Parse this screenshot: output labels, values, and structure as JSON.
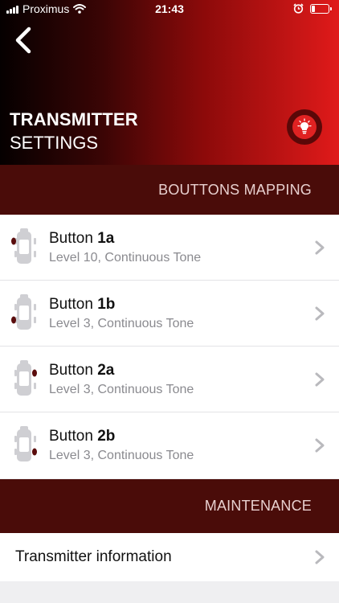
{
  "status_bar": {
    "carrier": "Proximus",
    "time": "21:43",
    "battery_level": 0.2
  },
  "header": {
    "back_icon": "chevron-left-icon",
    "title_line1": "TRANSMITTER",
    "title_line2": "SETTINGS",
    "action_icon": "lightbulb-icon"
  },
  "sections": {
    "buttons_mapping": "BOUTTONS MAPPING",
    "maintenance": "MAINTENANCE"
  },
  "buttons": [
    {
      "prefix": "Button ",
      "id": "1a",
      "detail": "Level 10, Continuous Tone",
      "indicator": "upper-left"
    },
    {
      "prefix": "Button ",
      "id": "1b",
      "detail": "Level 3, Continuous Tone",
      "indicator": "lower-left"
    },
    {
      "prefix": "Button ",
      "id": "2a",
      "detail": "Level 3, Continuous Tone",
      "indicator": "upper-right"
    },
    {
      "prefix": "Button ",
      "id": "2b",
      "detail": "Level 3, Continuous Tone",
      "indicator": "lower-right"
    }
  ],
  "maintenance_items": [
    {
      "label": "Transmitter information"
    }
  ],
  "colors": {
    "accent": "#e01a1a",
    "section_band": "#4a0c09",
    "indicator": "#5a0c0c"
  }
}
